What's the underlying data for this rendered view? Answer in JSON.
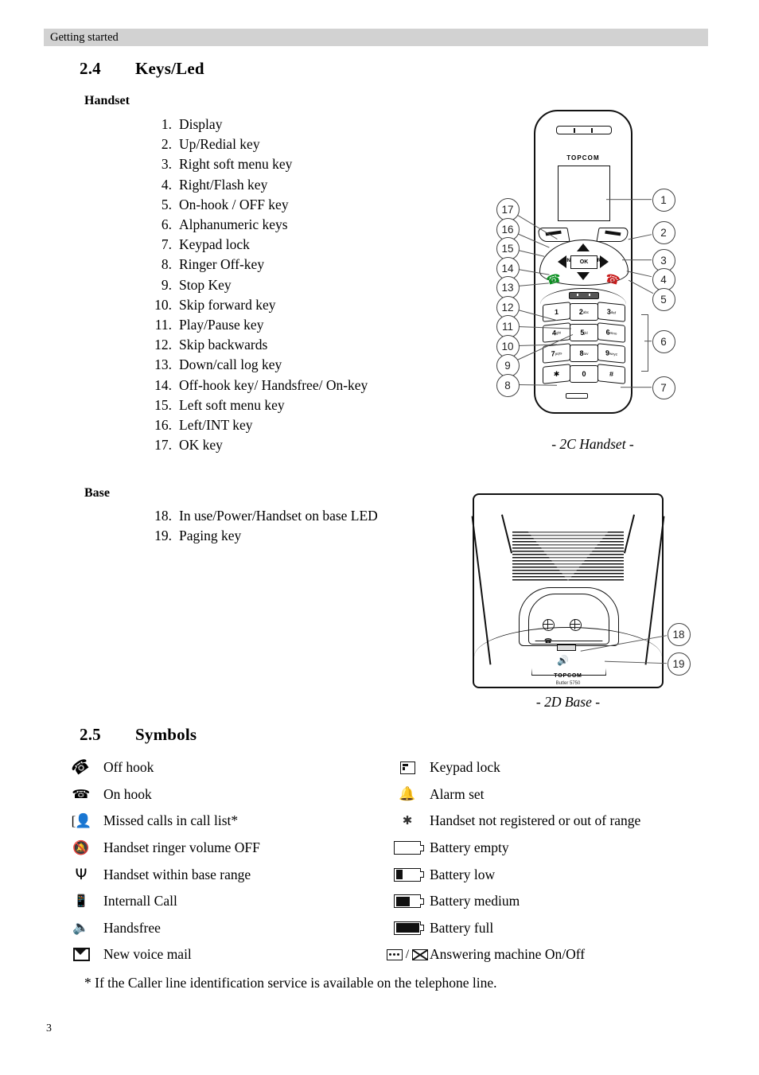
{
  "header": {
    "running_head": "Getting started"
  },
  "sections": {
    "keys_led": {
      "number": "2.4",
      "title": "Keys/Led"
    },
    "symbols": {
      "number": "2.5",
      "title": "Symbols"
    }
  },
  "handset": {
    "subheading": "Handset",
    "caption": "- 2C Handset -",
    "brand": "TOPCOM",
    "items": [
      {
        "n": "1.",
        "label": "Display"
      },
      {
        "n": "2.",
        "label": "Up/Redial key"
      },
      {
        "n": "3.",
        "label": "Right soft menu key"
      },
      {
        "n": "4.",
        "label": "Right/Flash key"
      },
      {
        "n": "5.",
        "label": "On-hook / OFF key"
      },
      {
        "n": "6.",
        "label": "Alphanumeric keys"
      },
      {
        "n": "7.",
        "label": "Keypad lock"
      },
      {
        "n": "8.",
        "label": "Ringer Off-key"
      },
      {
        "n": "9.",
        "label": "Stop Key"
      },
      {
        "n": "10.",
        "label": "Skip forward key"
      },
      {
        "n": "11.",
        "label": "Play/Pause key"
      },
      {
        "n": "12.",
        "label": "Skip backwards"
      },
      {
        "n": "13.",
        "label": "Down/call log key"
      },
      {
        "n": "14.",
        "label": "Off-hook key/ Handsfree/ On-key"
      },
      {
        "n": "15.",
        "label": "Left soft menu key"
      },
      {
        "n": "16.",
        "label": "Left/INT key"
      },
      {
        "n": "17.",
        "label": "OK key"
      }
    ],
    "callouts_left": [
      "17",
      "16",
      "15",
      "14",
      "13",
      "12",
      "11",
      "10",
      "9",
      "8"
    ],
    "callouts_right": [
      "1",
      "2",
      "3",
      "4",
      "5",
      "6",
      "7"
    ],
    "keypad": [
      [
        {
          "key": "1",
          "sub": ""
        },
        {
          "key": "2",
          "sub": "abc"
        },
        {
          "key": "3",
          "sub": "def"
        }
      ],
      [
        {
          "key": "4",
          "sub": "ghi"
        },
        {
          "key": "5",
          "sub": "jkl"
        },
        {
          "key": "6",
          "sub": "mno"
        }
      ],
      [
        {
          "key": "7",
          "sub": "pqrs"
        },
        {
          "key": "8",
          "sub": "tuv"
        },
        {
          "key": "9",
          "sub": "wxyz"
        }
      ],
      [
        {
          "key": "✱",
          "sub": ""
        },
        {
          "key": "0",
          "sub": ""
        },
        {
          "key": "#",
          "sub": ""
        }
      ]
    ],
    "nav": {
      "ok": "OK",
      "left": "INT",
      "right": "R"
    }
  },
  "base": {
    "subheading": "Base",
    "caption": "- 2D Base -",
    "brand": "TOPCOM",
    "model": "Butler 5750",
    "items": [
      {
        "n": "18.",
        "label": "In use/Power/Handset on base LED"
      },
      {
        "n": "19.",
        "label": "Paging key"
      }
    ],
    "callouts": [
      "18",
      "19"
    ]
  },
  "symbols": {
    "left": [
      {
        "icon": "off-hook-icon",
        "glyph": "✆",
        "label": "Off hook"
      },
      {
        "icon": "on-hook-icon",
        "glyph": "☎",
        "label": "On hook"
      },
      {
        "icon": "missed-calls-icon",
        "glyph": "",
        "label": "Missed calls in call list*"
      },
      {
        "icon": "ringer-off-icon",
        "glyph": "",
        "label": "Handset ringer volume OFF"
      },
      {
        "icon": "antenna-in-range-icon",
        "glyph": "",
        "label": "Handset within base range"
      },
      {
        "icon": "internal-call-icon",
        "glyph": "",
        "label": "Internall Call"
      },
      {
        "icon": "handsfree-speaker-icon",
        "glyph": "",
        "label": "Handsfree"
      },
      {
        "icon": "voice-mail-envelope-icon",
        "glyph": "",
        "label": "New voice mail"
      }
    ],
    "right": [
      {
        "icon": "keypad-lock-icon",
        "label": "Keypad lock"
      },
      {
        "icon": "alarm-bell-icon",
        "label": "Alarm set"
      },
      {
        "icon": "not-registered-icon",
        "label": "Handset not registered or out of range"
      },
      {
        "icon": "battery-empty-icon",
        "label": "Battery empty",
        "fill": 0
      },
      {
        "icon": "battery-low-icon",
        "label": "Battery low",
        "fill": 30
      },
      {
        "icon": "battery-medium-icon",
        "label": "Battery medium",
        "fill": 62
      },
      {
        "icon": "battery-full-icon",
        "label": "Battery full",
        "fill": 100
      },
      {
        "icon": "answering-machine-icon",
        "label": "Answering machine On/Off",
        "separator": "/"
      }
    ]
  },
  "footnote": "* If the Caller line identification service is available on the telephone line.",
  "page_number": "3"
}
